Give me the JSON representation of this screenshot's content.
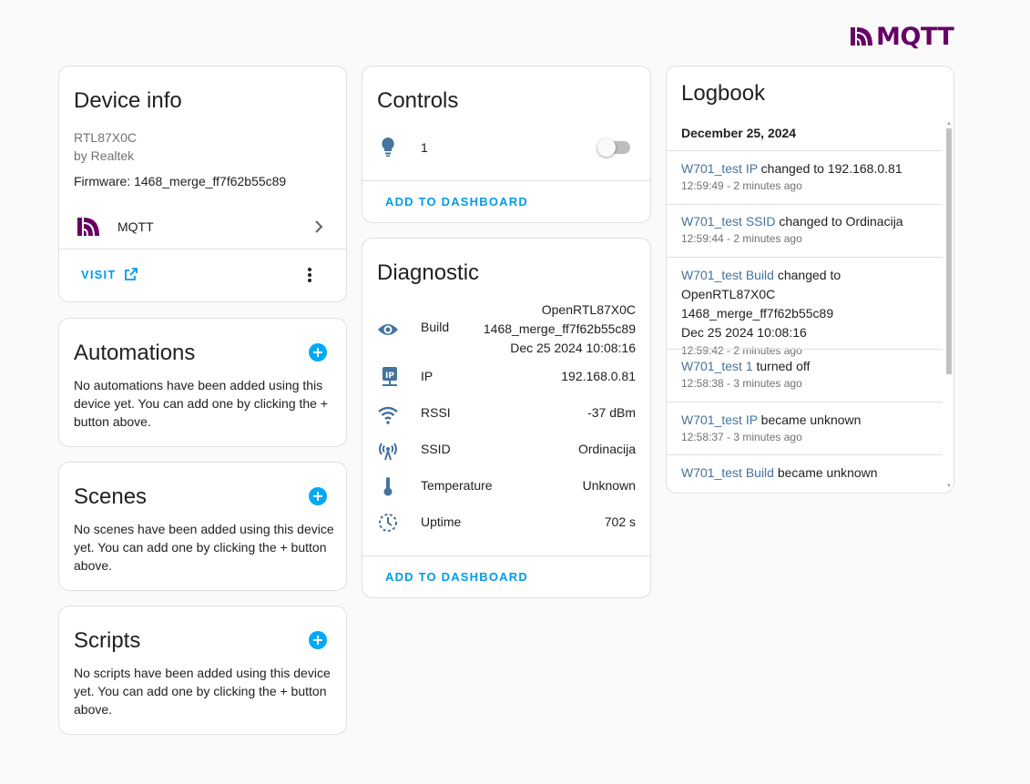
{
  "brand": {
    "name": "MQTT",
    "color": "#660066"
  },
  "device_info": {
    "title": "Device info",
    "model": "RTL87X0C",
    "manufacturer": "by Realtek",
    "firmware": "Firmware: 1468_merge_ff7f62b55c89",
    "integration": "MQTT",
    "visit_label": "VISIT"
  },
  "automations": {
    "title": "Automations",
    "text": "No automations have been added using this device yet. You can add one by clicking the + button above."
  },
  "scenes": {
    "title": "Scenes",
    "text": "No scenes have been added using this device yet. You can add one by clicking the + button above."
  },
  "scripts": {
    "title": "Scripts",
    "text": "No scripts have been added using this device yet. You can add one by clicking the + button above."
  },
  "controls": {
    "title": "Controls",
    "item_label": "1",
    "toggle_on": false,
    "add_label": "ADD TO DASHBOARD"
  },
  "diagnostic": {
    "title": "Diagnostic",
    "rows": [
      {
        "icon": "eye-icon",
        "label": "Build",
        "value_lines": [
          "OpenRTL87X0C",
          "1468_merge_ff7f62b55c89",
          "Dec 25 2024 10:08:16"
        ]
      },
      {
        "icon": "ip-icon",
        "label": "IP",
        "value": "192.168.0.81"
      },
      {
        "icon": "wifi-icon",
        "label": "RSSI",
        "value": "-37 dBm"
      },
      {
        "icon": "access-point-icon",
        "label": "SSID",
        "value": "Ordinacija"
      },
      {
        "icon": "thermometer-icon",
        "label": "Temperature",
        "value": "Unknown"
      },
      {
        "icon": "timer-icon",
        "label": "Uptime",
        "value": "702 s"
      }
    ],
    "add_label": "ADD TO DASHBOARD"
  },
  "logbook": {
    "title": "Logbook",
    "date": "December 25, 2024",
    "entries": [
      {
        "entity": "W701_test IP",
        "message": " changed to 192.168.0.81",
        "time": "12:59:49 - 2 minutes ago"
      },
      {
        "entity": "W701_test SSID",
        "message": " changed to Ordinacija",
        "time": "12:59:44 - 2 minutes ago"
      },
      {
        "entity": "W701_test Build",
        "message": " changed to",
        "message2": "OpenRTL87X0C 1468_merge_ff7f62b55c89",
        "message3": "Dec 25 2024 10:08:16",
        "time": "12:59:42 - 2 minutes ago"
      },
      {
        "entity": "W701_test 1",
        "message": " turned off",
        "time": "12:58:38 - 3 minutes ago"
      },
      {
        "entity": "W701_test IP",
        "message": " became unknown",
        "time": "12:58:37 - 3 minutes ago"
      },
      {
        "entity": "W701_test Build",
        "message": " became unknown",
        "time": ""
      }
    ]
  }
}
